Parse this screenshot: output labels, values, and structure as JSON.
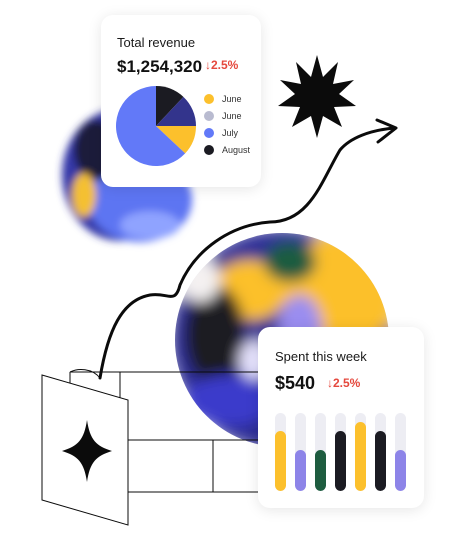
{
  "revenue_card": {
    "title": "Total revenue",
    "amount": "$1,254,320",
    "delta": "2.5%",
    "delta_color": "#e5483d",
    "legend": [
      {
        "label": "June",
        "color": "#fcc02c"
      },
      {
        "label": "June",
        "color": "#b9bbd0"
      },
      {
        "label": "July",
        "color": "#6279f8"
      },
      {
        "label": "August",
        "color": "#1b1b22"
      }
    ],
    "pie": [
      {
        "label": "August",
        "value": 12,
        "color": "#1b1b22"
      },
      {
        "label": "June",
        "value": 13,
        "color": "#33348c"
      },
      {
        "label": "June",
        "value": 12,
        "color": "#fcc02c"
      },
      {
        "label": "July",
        "value": 63,
        "color": "#6279f8"
      }
    ]
  },
  "spent_card": {
    "title": "Spent this week",
    "amount": "$540",
    "delta": "2.5%",
    "bars": [
      {
        "level": 0.77,
        "color": "#fcc02c"
      },
      {
        "level": 0.53,
        "color": "#8d84e8"
      },
      {
        "level": 0.53,
        "color": "#1e5c3f"
      },
      {
        "level": 0.77,
        "color": "#1b1b22"
      },
      {
        "level": 0.88,
        "color": "#fcc02c"
      },
      {
        "level": 0.77,
        "color": "#1b1b22"
      },
      {
        "level": 0.53,
        "color": "#8d84e8"
      }
    ]
  },
  "decorations": {
    "starburst_icon": "black-starburst",
    "sparkle_icon": "four-point-star",
    "arrow": "curved-arrow"
  }
}
